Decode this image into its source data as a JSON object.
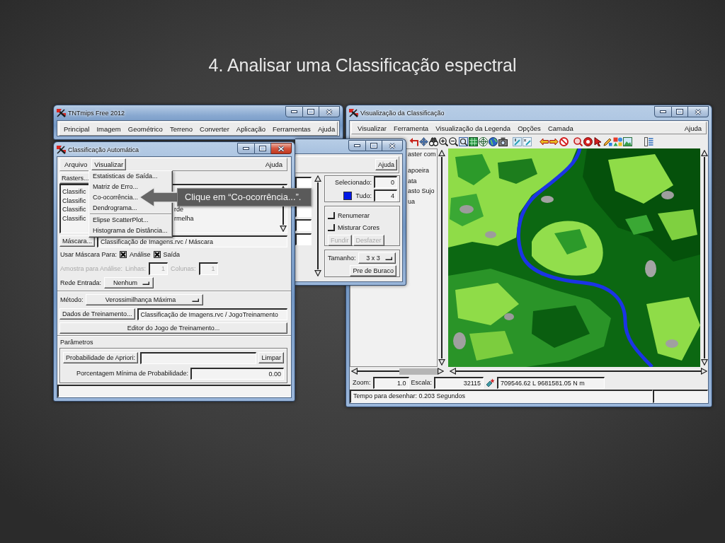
{
  "slide_title": "4. Analisar uma Classificação espectral",
  "main_window": {
    "title": "TNTmips Free 2012",
    "active": false,
    "menu": [
      "Principal",
      "Imagem",
      "Geométrico",
      "Terreno",
      "Converter",
      "Aplicação",
      "Ferramentas",
      "Ajuda"
    ]
  },
  "viewer_window": {
    "title": "Visualização da Classificação",
    "active": false,
    "menu": [
      "Visualizar",
      "Ferramenta",
      "Visualização da Legenda",
      "Opções",
      "Camada",
      "Ajuda"
    ],
    "legend_header": "aster com",
    "legend_items": [
      "apoeira",
      "ata",
      "asto Sujo",
      "ua"
    ],
    "zoom_label": "Zoom:",
    "zoom_value": "1.0",
    "scale_label": "Escala:",
    "scale_value": "32115",
    "coordinates": "709546.62 L 9681581.05 N m",
    "status": "Tempo para desenhar: 0.203 Segundos"
  },
  "class_dialog": {
    "active": false,
    "help_button": "Ajuda",
    "selected_label": "Selecionado:",
    "selected_value": "0",
    "all_label": "Tudo:",
    "all_value": "4",
    "options": [
      {
        "label": "Renumerar",
        "checked": false
      },
      {
        "label": "Misturar Cores",
        "checked": false
      }
    ],
    "actions": [
      {
        "label": "Fundir",
        "disabled": true
      },
      {
        "label": "Desfazer",
        "disabled": true
      }
    ],
    "size_label": "Tamanho:",
    "size_value": "3 x 3",
    "fill_button": "Pre de Buraco"
  },
  "classification_window": {
    "title": "Classificação Automática",
    "active": true,
    "menu": [
      {
        "label": "Arquivo",
        "selected": false
      },
      {
        "label": "Visualizar",
        "selected": true
      },
      {
        "label": "Ajuda",
        "selected": false
      }
    ],
    "open_menu": [
      [
        "Estatisticas de Saída...",
        "Matriz de Erro...",
        "Co-ocorrência...",
        "Dendrograma..."
      ],
      [
        "Elipse ScatterPlot...",
        "Histograma de Distância..."
      ]
    ],
    "rasters_button": "Rasters...",
    "raster_list": [
      {
        "text_left": "Classific"
      },
      {
        "text_left": "Classific"
      },
      {
        "text_left": "Classific",
        "text_right": "rde"
      },
      {
        "text_left": "Classific",
        "text_right": "rmelha"
      }
    ],
    "mask_button": "Máscara...",
    "mask_value": "Classificação de Imagens.rvc / Máscara",
    "use_mask_label": "Usar Máscara Para:",
    "use_mask_options": [
      {
        "label": "Análise",
        "checked": true
      },
      {
        "label": "Saída",
        "checked": true
      }
    ],
    "sample": {
      "label": "Amostra para Análise:",
      "disabled": true,
      "fields": [
        {
          "label": "Linhas:",
          "value": "1"
        },
        {
          "label": "Colunas:",
          "value": "1"
        }
      ]
    },
    "input_network": {
      "label": "Rede Entrada:",
      "value": "Nenhum"
    },
    "method": {
      "label": "Método:",
      "value": "Verossimilhança Máxima"
    },
    "training_button": "Dados de Treinamento...",
    "training_value": "Classificação de Imagens.rvc / JogoTreinamento",
    "editor_button": "Editor do Jogo de Treinamento...",
    "parameters": {
      "title": "Parâmetros",
      "apriori_button": "Probabilidade de Apriori:",
      "clear_button": "Limpar",
      "min_probability_label": "Porcentagem Mínima de Probabilidade:",
      "min_probability_value": "0.00"
    }
  },
  "callout": {
    "text": "Clique em “Co-ocorrência...”."
  }
}
